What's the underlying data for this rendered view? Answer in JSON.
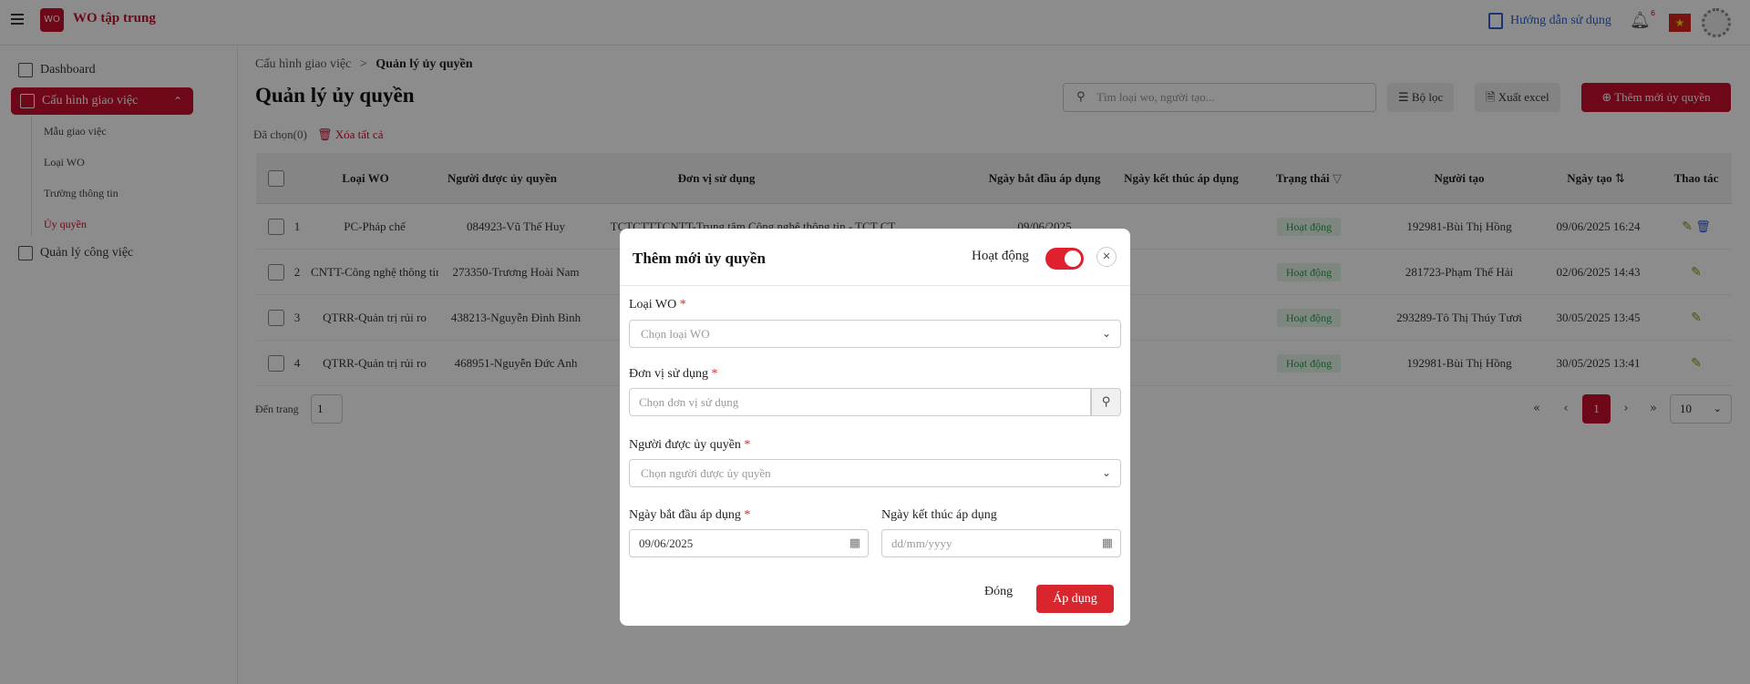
{
  "header": {
    "app_title": "WO tập trung",
    "logo_text": "WO",
    "guide_label": "Hướng dẫn sử dụng",
    "notification_count": "6"
  },
  "sidebar": {
    "dashboard": "Dashboard",
    "config": "Cấu hình giao việc",
    "sub_items": [
      "Mẫu giao việc",
      "Loại WO",
      "Trường thông tin",
      "Ủy quyền"
    ],
    "work_mgmt": "Quản lý công việc"
  },
  "breadcrumb": {
    "parent": "Cấu hình giao việc",
    "separator": ">",
    "current": "Quản lý ủy quyền"
  },
  "page_title": "Quản lý ủy quyền",
  "toolbar": {
    "search_placeholder": "Tìm loại wo, người tạo...",
    "filter_label": "Bộ lọc",
    "export_label": "Xuất excel",
    "add_label": "Thêm mới ủy quyền"
  },
  "selection": {
    "selected_label": "Đã chọn(0)",
    "clear_all_label": "Xóa tất cả"
  },
  "table": {
    "headers": [
      "Loại WO",
      "Người được ủy quyền",
      "Đơn vị sử dụng",
      "Ngày bắt đầu áp dụng",
      "Ngày kết thúc áp dụng",
      "Trạng thái",
      "Người tạo",
      "Ngày tạo",
      "Thao tác"
    ],
    "rows": [
      {
        "no": "1",
        "type": "PC-Pháp chế",
        "person": "084923-Vũ Thế Huy",
        "unit": "TCTCTTTCNTT-Trung tâm Công nghệ thông tin - TCT CT",
        "start": "09/06/2025",
        "end": "",
        "status": "Hoạt động",
        "creator": "192981-Bùi Thị Hồng",
        "created": "09/06/2025 16:24"
      },
      {
        "no": "2",
        "type": "CNTT-Công nghệ thông tin",
        "person": "273350-Trương Hoài Nam",
        "unit": "",
        "start": "",
        "end": "",
        "status": "Hoạt động",
        "creator": "281723-Phạm Thế Hải",
        "created": "02/06/2025 14:43"
      },
      {
        "no": "3",
        "type": "QTRR-Quản trị rủi ro",
        "person": "438213-Nguyễn Đình Bình",
        "unit": "",
        "start": "",
        "end": "",
        "status": "Hoạt động",
        "creator": "293289-Tô Thị Thúy Tươi",
        "created": "30/05/2025 13:45"
      },
      {
        "no": "4",
        "type": "QTRR-Quản trị rủi ro",
        "person": "468951-Nguyễn Đức Anh",
        "unit": "",
        "start": "",
        "end": "",
        "status": "Hoạt động",
        "creator": "192981-Bùi Thị Hồng",
        "created": "30/05/2025 13:41"
      }
    ]
  },
  "pagination": {
    "goto_label": "Đến trang",
    "goto_value": "1",
    "current_page": "1",
    "page_size": "10"
  },
  "modal": {
    "title": "Thêm mới ủy quyền",
    "active_label": "Hoạt động",
    "active": true,
    "wo_type_label": "Loại WO",
    "wo_type_placeholder": "Chọn loại WO",
    "unit_label": "Đơn vị sử dụng",
    "unit_placeholder": "Chọn đơn vị sử dụng",
    "person_label": "Người được ủy quyền",
    "person_placeholder": "Chọn người được ủy quyền",
    "start_label": "Ngày bắt đầu áp dụng",
    "start_value": "09/06/2025",
    "end_label": "Ngày kết thúc áp dụng",
    "end_placeholder": "dd/mm/yyyy",
    "required_mark": "*",
    "close_label": "Đóng",
    "apply_label": "Áp dụng"
  },
  "colors": {
    "brand": "#c8102e",
    "link": "#2d5fd3",
    "status_bg": "#e3f5e8",
    "status_text": "#2c9a4b"
  }
}
